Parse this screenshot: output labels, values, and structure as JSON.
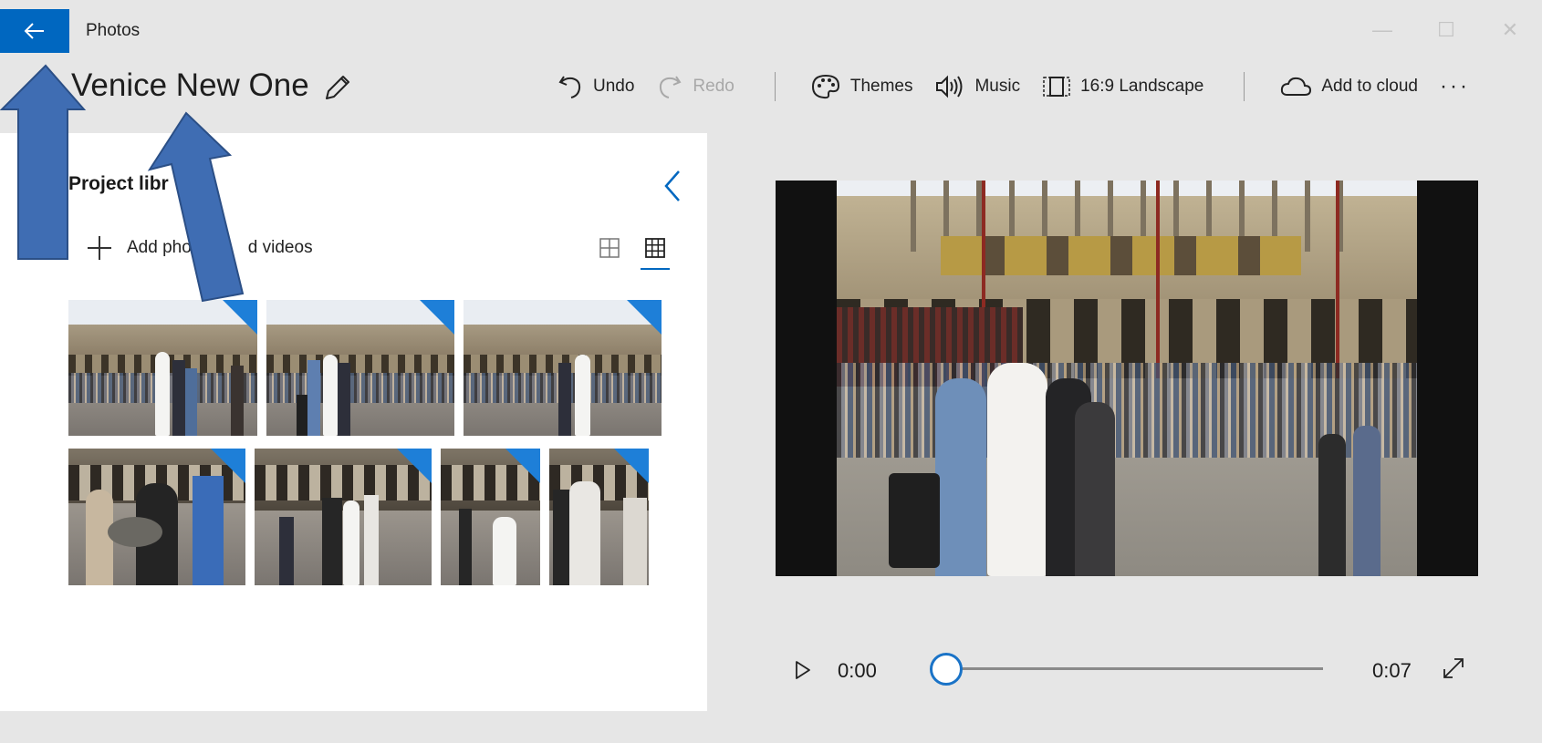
{
  "window": {
    "app_title": "Photos",
    "minimize_glyph": "—",
    "maximize_glyph": "☐",
    "close_glyph": "✕"
  },
  "project": {
    "title": "Venice New One"
  },
  "toolbar": {
    "undo": "Undo",
    "redo": "Redo",
    "themes": "Themes",
    "music": "Music",
    "aspect": "16:9 Landscape",
    "cloud": "Add to cloud",
    "more": "···"
  },
  "library": {
    "title": "Project libr",
    "add_label_a": "Add pho",
    "add_label_b": "d videos",
    "thumbnails": 7
  },
  "playback": {
    "current_time": "0:00",
    "total_time": "0:07",
    "progress": 0
  },
  "colors": {
    "accent": "#0067c0",
    "annotation_arrow": "#3f6db3"
  },
  "icons": [
    "back-arrow-icon",
    "pencil-icon",
    "undo-icon",
    "redo-icon",
    "palette-icon",
    "speaker-icon",
    "aspect-ratio-icon",
    "cloud-icon",
    "chevron-left-icon",
    "plus-icon",
    "large-grid-icon",
    "small-grid-icon",
    "play-icon",
    "expand-icon"
  ]
}
